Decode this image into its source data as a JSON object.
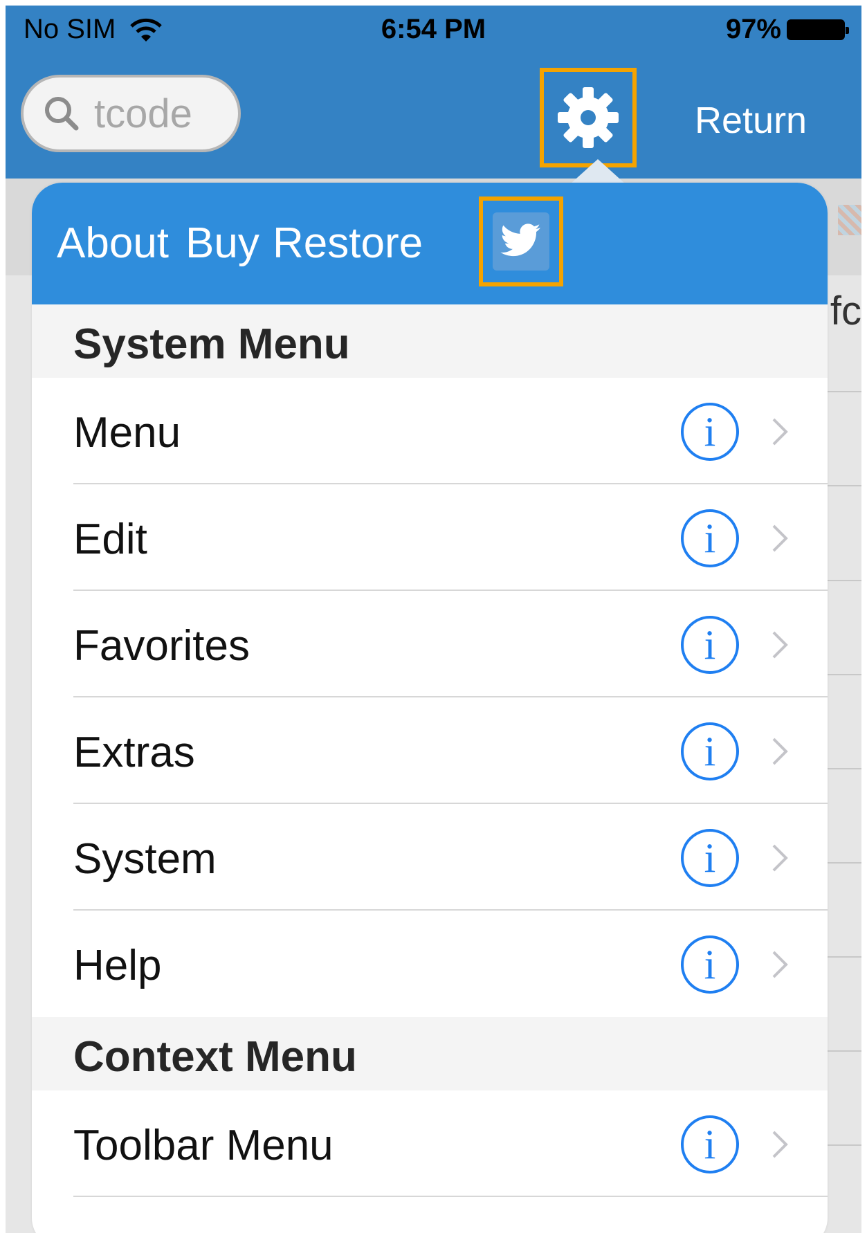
{
  "status_bar": {
    "carrier": "No SIM",
    "time": "6:54 PM",
    "battery": "97%"
  },
  "nav": {
    "search_placeholder": "tcode",
    "return_label": "Return"
  },
  "background": {
    "partial_text": "fc"
  },
  "popover": {
    "header_links": [
      "About",
      "Buy",
      "Restore"
    ],
    "sections": [
      {
        "title": "System Menu",
        "items": [
          "Menu",
          "Edit",
          "Favorites",
          "Extras",
          "System",
          "Help"
        ]
      },
      {
        "title": "Context Menu",
        "items": [
          "Toolbar Menu"
        ]
      }
    ],
    "info_glyph": "i"
  },
  "icons": {
    "search": "search-icon",
    "settings": "gear-icon",
    "twitter": "twitter-icon",
    "info": "info-icon",
    "chevron": "chevron-right-icon",
    "wifi": "wifi-icon",
    "battery": "battery-icon"
  },
  "colors": {
    "nav_bar": "#3482c4",
    "popover_header": "#2f8ddc",
    "highlight_box": "#f5a300",
    "info_blue": "#1f7ff1"
  }
}
